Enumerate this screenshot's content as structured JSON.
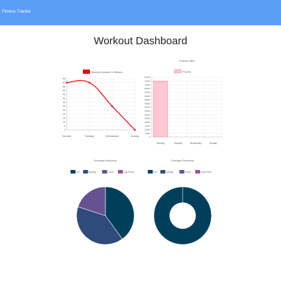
{
  "navbar": {
    "brand": "Fitness Tracker"
  },
  "page": {
    "title": "Workout Dashboard"
  },
  "chart_data": [
    {
      "type": "line",
      "title": "",
      "series": [
        {
          "name": "Workout Duration in Minutes",
          "color": "#e8000b"
        }
      ],
      "categories": [
        "Monday",
        "Tuesday",
        "Wednesday",
        "Sunday"
      ],
      "values": [
        60,
        60,
        30,
        0
      ],
      "yticks": [
        0,
        5,
        10,
        15,
        20,
        25,
        30,
        35,
        40,
        45,
        50,
        55,
        60,
        65
      ],
      "ylim": [
        0,
        65
      ],
      "grid": true,
      "legend": "top"
    },
    {
      "type": "bar",
      "title": "Pounds Lifted",
      "series": [
        {
          "name": "Pounds",
          "color": "#ffc8d2",
          "border": "#f07a8f"
        }
      ],
      "categories": [
        "Monday",
        "Tuesday",
        "Wednesday",
        "Sunday"
      ],
      "values": [
        75000,
        0,
        0,
        0
      ],
      "yticks": [
        0,
        5000,
        10000,
        15000,
        20000,
        25000,
        30000,
        35000,
        40000,
        45000,
        50000,
        55000,
        60000,
        65000,
        70000,
        75000,
        80000
      ],
      "ylim": [
        0,
        80000
      ],
      "grid": true,
      "legend": "top"
    },
    {
      "type": "pie",
      "title": "Exercises Performed",
      "labels": [
        "run",
        "cycling",
        "Curls",
        "Leg Press"
      ],
      "colors": [
        "#003f5c",
        "#2f4b7c",
        "#665191",
        "#a05195"
      ],
      "values": [
        40,
        40,
        20,
        0
      ],
      "legend": "top"
    },
    {
      "type": "doughnut",
      "title": "Exercises Performed",
      "labels": [
        "run",
        "cycling",
        "Curls",
        "Leg Press"
      ],
      "colors": [
        "#003f5c",
        "#2f4b7c",
        "#665191",
        "#a05195"
      ],
      "values": [
        1,
        0,
        0,
        0
      ],
      "legend": "top"
    }
  ]
}
